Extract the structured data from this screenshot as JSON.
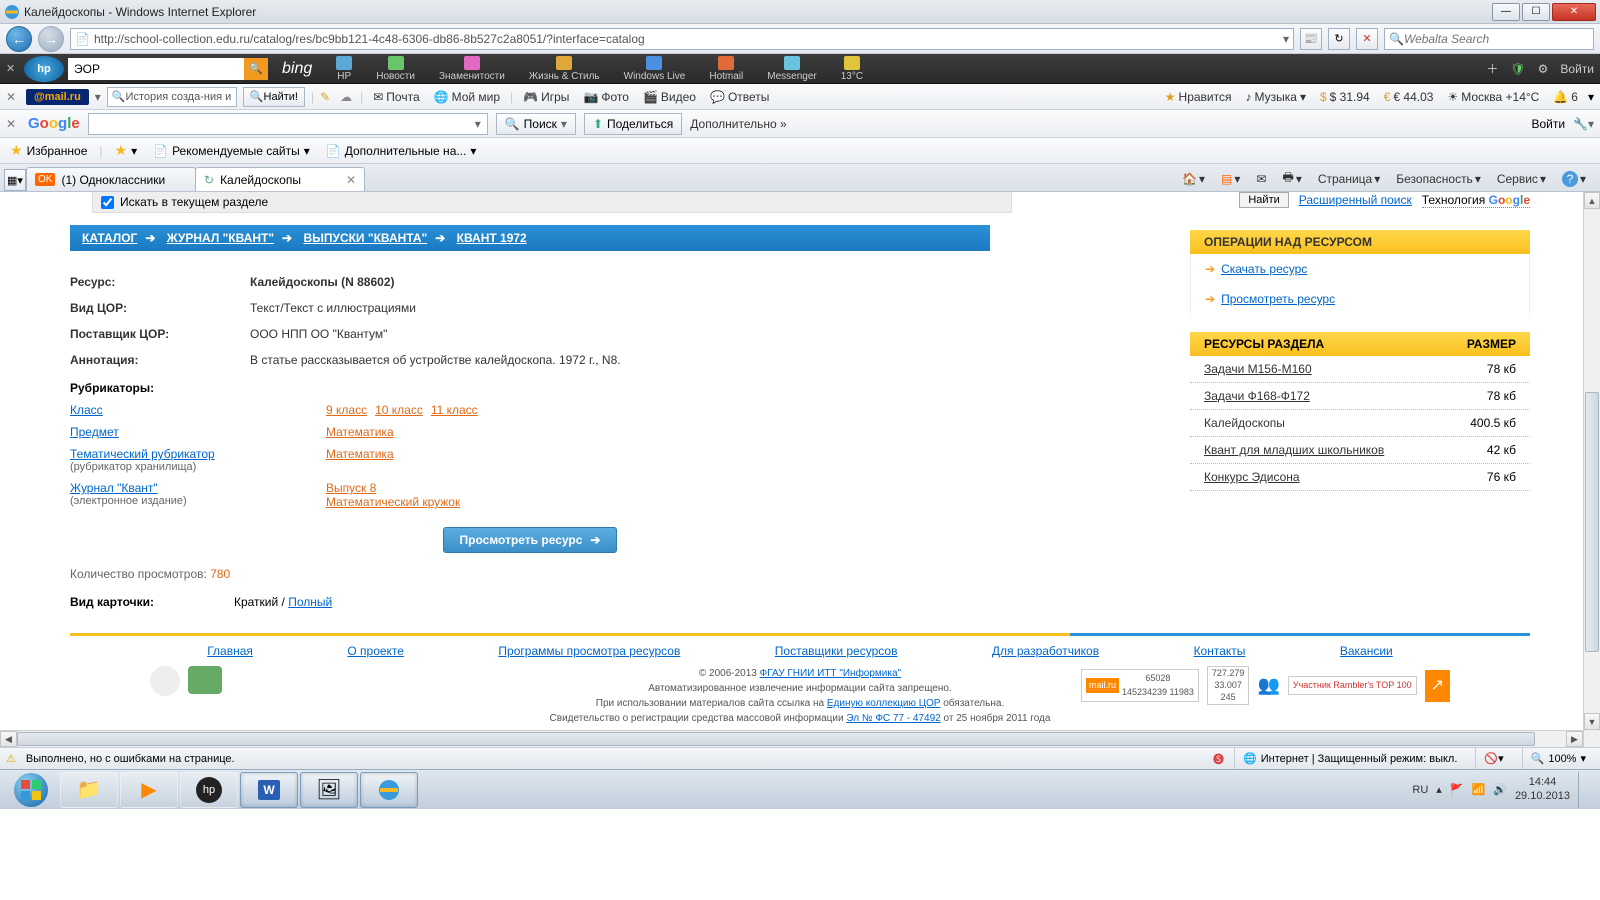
{
  "window": {
    "title": "Калейдоскопы - Windows Internet Explorer",
    "url": "http://school-collection.edu.ru/catalog/res/bc9bb121-4c48-6306-db86-8b527c2a8051/?interface=catalog",
    "search_placeholder": "Webalta Search"
  },
  "hp_bar": {
    "search_value": "ЭОР",
    "bing_label": "bing",
    "items": [
      "HP",
      "Новости",
      "Знаменитости",
      "Жизнь & Стиль",
      "Windows Live",
      "Hotmail",
      "Messenger",
      "13°C"
    ],
    "login": "Войти"
  },
  "mail_bar": {
    "logo": "@mail.ru",
    "history": "История созда-ния и",
    "find": "Найти!",
    "links": [
      "Почта",
      "Мой мир",
      "Игры",
      "Фото",
      "Видео",
      "Ответы"
    ],
    "right": {
      "like": "Нравится",
      "music": "Музыка",
      "usd": "$ 31.94",
      "eur": "€ 44.03",
      "weather": "Москва +14°C",
      "count": "6"
    }
  },
  "goog_bar": {
    "search": "Поиск",
    "share": "Поделиться",
    "more": "Дополнительно »",
    "login": "Войти"
  },
  "fav_bar": {
    "favorites": "Избранное",
    "recommended": "Рекомендуемые сайты",
    "additional": "Дополнительные на..."
  },
  "tabs": {
    "tab1": "(1) Одноклассники",
    "tab2": "Калейдоскопы"
  },
  "tab_tools": {
    "page": "Страница",
    "safety": "Безопасность",
    "service": "Сервис"
  },
  "page": {
    "search_current": "Искать в текущем разделе",
    "find_btn": "Найти",
    "adv_search": "Расширенный поиск",
    "tech": "Технология",
    "google": "Google",
    "breadcrumb": [
      "КАТАЛОГ",
      "ЖУРНАЛ \"КВАНТ\"",
      "ВЫПУСКИ \"КВАНТА\"",
      "КВАНТ 1972"
    ],
    "info": {
      "resource_l": "Ресурс:",
      "resource_v": "Калейдоскопы (N 88602)",
      "type_l": "Вид ЦОР:",
      "type_v": "Текст/Текст с иллюстрациями",
      "provider_l": "Поставщик ЦОР:",
      "provider_v": "ООО НПП ОО \"Квантум\"",
      "annot_l": "Аннотация:",
      "annot_v": "В статье рассказывается об устройстве калейдоскопа. 1972 г., N8."
    },
    "rubr_head": "Рубрикаторы:",
    "rubr": [
      {
        "key": "Класс",
        "sub": "",
        "vals": [
          "9 класс",
          "10 класс",
          "11 класс"
        ]
      },
      {
        "key": "Предмет",
        "sub": "",
        "vals": [
          "Математика"
        ]
      },
      {
        "key": "Тематический рубрикатор",
        "sub": "(рубрикатор хранилища)",
        "vals": [
          "Математика"
        ]
      },
      {
        "key": "Журнал \"Квант\"",
        "sub": "(электронное издание)",
        "vals": [
          "Выпуск 8",
          "Математический кружок"
        ]
      }
    ],
    "view_btn": "Просмотреть ресурс",
    "views_label": "Количество просмотров:",
    "views_n": "780",
    "card_l": "Вид карточки:",
    "card_short": "Краткий",
    "card_full": "Полный"
  },
  "sidebar": {
    "ops_head": "ОПЕРАЦИИ НАД РЕСУРСОМ",
    "download": "Скачать ресурс",
    "view": "Просмотреть ресурс",
    "res_head_name": "РЕСУРСЫ РАЗДЕЛА",
    "res_head_size": "РАЗМЕР",
    "rows": [
      {
        "name": "Задачи М156-М160",
        "size": "78 кб",
        "link": true
      },
      {
        "name": "Задачи Ф168-Ф172",
        "size": "78 кб",
        "link": true
      },
      {
        "name": "Калейдоскопы",
        "size": "400.5 кб",
        "link": false
      },
      {
        "name": "Квант для младших школьников",
        "size": "42 кб",
        "link": true
      },
      {
        "name": "Конкурс Эдисона",
        "size": "76 кб",
        "link": true
      }
    ]
  },
  "footer": {
    "links": [
      "Главная",
      "О проекте",
      "Программы просмотра ресурсов",
      "Поставщики ресурсов",
      "Для разработчиков",
      "Контакты",
      "Вакансии"
    ],
    "copyright": "© 2006-2013",
    "org": "ФГАУ ГНИИ ИТТ \"Информика\"",
    "line2": "Автоматизированное извлечение информации сайта запрещено.",
    "line3a": "При использовании материалов сайта ссылка на",
    "line3link": "Единую коллекцию ЦОР",
    "line3b": "обязательна.",
    "line4a": "Свидетельство о регистрации средства массовой информации",
    "line4link": "Эл № ФС 77 - 47492",
    "line4b": "от 25 ноября 2011 года",
    "counter1": {
      "top": "65028",
      "bot": "145234239  11983"
    },
    "counter2": {
      "l1": "727.279",
      "l2": "33.007",
      "l3": "245"
    },
    "rambler": "Участник Rambler's TOP 100"
  },
  "statusbar": {
    "msg": "Выполнено, но с ошибками на странице.",
    "zone": "Интернет | Защищенный режим: выкл.",
    "zoom": "100%"
  },
  "taskbar": {
    "lang": "RU",
    "time": "14:44",
    "date": "29.10.2013"
  }
}
